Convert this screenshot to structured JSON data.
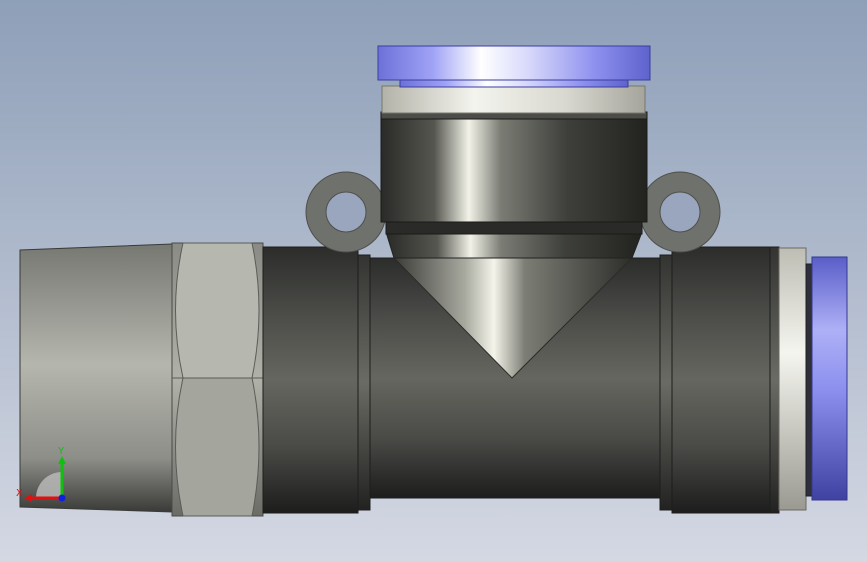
{
  "viewport": {
    "background_top": "#8e9fb8",
    "background_bottom": "#d4d8e3"
  },
  "colors": {
    "fitting_body": "#5c5d58",
    "release_collar_blue": "#8a8ff0",
    "silver_ring": "#d9d9d2",
    "ear_gray": "#6f716c"
  },
  "triad": {
    "x_label": "X",
    "y_label": "Y",
    "x_color": "#e01010",
    "y_color": "#10c010",
    "z_color": "#1020e0"
  }
}
